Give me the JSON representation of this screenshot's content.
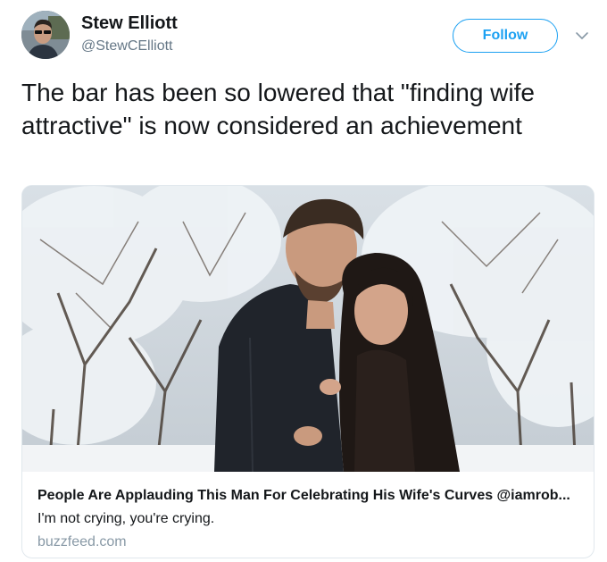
{
  "author": {
    "display_name": "Stew Elliott",
    "handle": "@StewCElliott"
  },
  "header": {
    "follow_label": "Follow",
    "more_icon": "chevron-down-icon"
  },
  "tweet": {
    "text": "The bar has been so lowered that \"finding wife attractive\" is now considered an achievement"
  },
  "card": {
    "title": "People Are Applauding This Man For Celebrating His Wife's Curves @iamrob...",
    "description": "I'm not crying, you're crying.",
    "domain": "buzzfeed.com"
  },
  "colors": {
    "accent": "#1da1f2",
    "text": "#14171a",
    "secondary": "#657786",
    "border": "#e1e8ed"
  }
}
